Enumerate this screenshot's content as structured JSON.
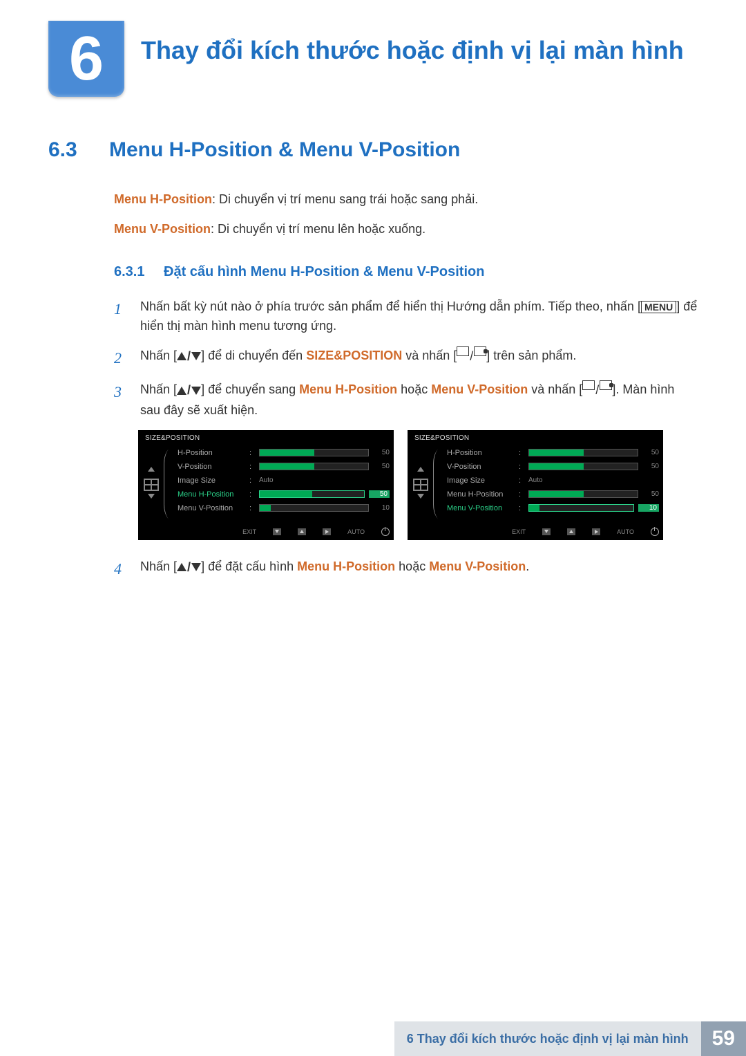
{
  "chapter": {
    "number": "6",
    "title": "Thay đổi kích thước hoặc định vị lại màn hình"
  },
  "section": {
    "number": "6.3",
    "title": "Menu H-Position & Menu V-Position"
  },
  "desc_h": {
    "label": "Menu H-Position",
    "text": ": Di chuyển vị trí menu sang trái hoặc sang phải."
  },
  "desc_v": {
    "label": "Menu V-Position",
    "text": ": Di chuyển vị trí menu lên hoặc xuống."
  },
  "subsection": {
    "number": "6.3.1",
    "title": "Đặt cấu hình Menu H-Position & Menu V-Position"
  },
  "steps": {
    "s1a": "Nhấn bất kỳ nút nào ở phía trước sản phẩm để hiển thị Hướng dẫn phím. Tiếp theo, nhấn [",
    "s1menu": "MENU",
    "s1b": "] để hiển thị màn hình menu tương ứng.",
    "s2a": "Nhấn [",
    "s2b": "] để di chuyển đến ",
    "s2hl": "SIZE&POSITION",
    "s2c": " và nhấn [",
    "s2d": "] trên sản phẩm.",
    "s3a": "Nhấn [",
    "s3b": "] để chuyển sang ",
    "s3hl1": "Menu H-Position",
    "s3c": " hoặc ",
    "s3hl2": "Menu V-Position",
    "s3d": " và nhấn [",
    "s3e": "]. Màn hình sau đây sẽ xuất hiện.",
    "s4a": "Nhấn [",
    "s4b": "] để đặt cấu hình ",
    "s4hl1": "Menu H-Position",
    "s4c": " hoặc ",
    "s4hl2": "Menu V-Position",
    "s4d": "."
  },
  "osd": {
    "title": "SIZE&POSITION",
    "items": {
      "hpos": {
        "label": "H-Position",
        "value": "50",
        "fill": 50
      },
      "vpos": {
        "label": "V-Position",
        "value": "50",
        "fill": 50
      },
      "imgsize": {
        "label": "Image Size",
        "value": "Auto"
      },
      "mhpos": {
        "label": "Menu H-Position",
        "value": "50",
        "fill": 50
      },
      "mvpos": {
        "label": "Menu V-Position",
        "value": "10",
        "fill": 10
      }
    },
    "nav": {
      "exit": "EXIT",
      "auto": "AUTO"
    }
  },
  "footer": {
    "chapter_ref": "6 Thay đổi kích thước hoặc định vị lại màn hình",
    "page": "59"
  }
}
